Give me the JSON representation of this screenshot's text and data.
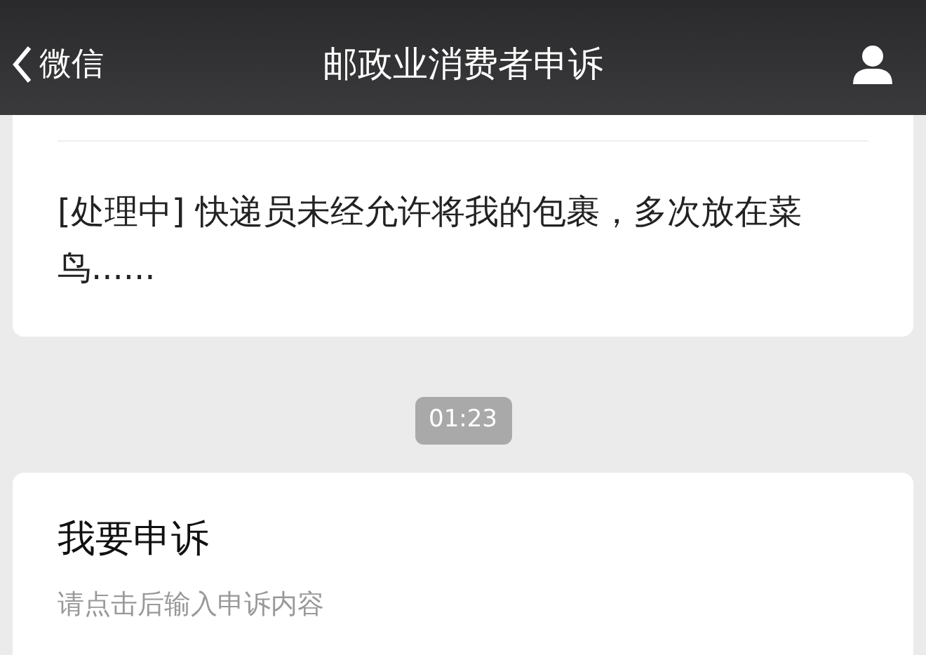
{
  "nav_bar": {
    "back_label": "微信",
    "title": "邮政业消费者申诉"
  },
  "complaint_card": {
    "text": "[处理中] 快递员未经允许将我的包裹，多次放在菜鸟......"
  },
  "timestamp": "01:23",
  "appeal_card": {
    "title": "我要申诉",
    "hint": "请点击后输入申诉内容"
  }
}
